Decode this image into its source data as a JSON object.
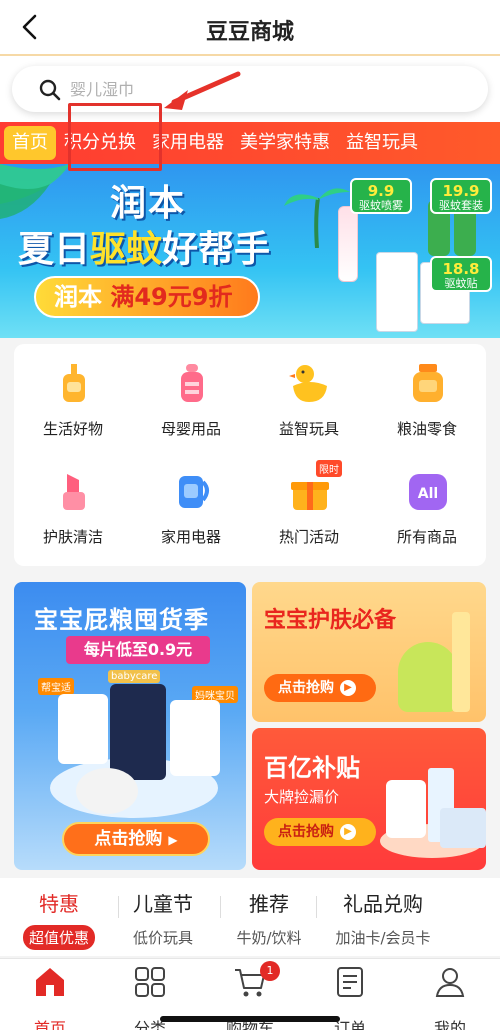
{
  "header": {
    "title": "豆豆商城"
  },
  "search": {
    "placeholder": "婴儿湿巾"
  },
  "category_tabs": [
    "首页",
    "积分兑换",
    "家用电器",
    "美学家特惠",
    "益智玩具"
  ],
  "banner": {
    "title_line1": "润本",
    "title_line2_pre": "夏日",
    "title_line2_highlight": "驱蚊",
    "title_line2_post": "好帮手",
    "pill_brand": "润本",
    "pill_offer": "满49元9折",
    "tags": [
      {
        "price": "9.9",
        "name": "驱蚊喷雾"
      },
      {
        "price": "19.9",
        "name": "驱蚊套装"
      },
      {
        "price": "18.8",
        "name": "驱蚊贴"
      }
    ]
  },
  "quick_grid": [
    {
      "label": "生活好物",
      "icon": "pump-bottle-icon",
      "color": "#ffb52e"
    },
    {
      "label": "母婴用品",
      "icon": "baby-bottle-icon",
      "color": "#ff6b8a"
    },
    {
      "label": "益智玩具",
      "icon": "duck-toy-icon",
      "color": "#ffc21f"
    },
    {
      "label": "粮油零食",
      "icon": "jar-icon",
      "color": "#ff9c1a"
    },
    {
      "label": "护肤清洁",
      "icon": "lipstick-icon",
      "color": "#ff5f7e"
    },
    {
      "label": "家用电器",
      "icon": "kettle-icon",
      "color": "#3f8ef7"
    },
    {
      "label": "热门活动",
      "icon": "gift-box-icon",
      "color": "#ffb21c",
      "badge": "限时"
    },
    {
      "label": "所有商品",
      "icon": "all-icon",
      "color": "#a166f2",
      "text": "All"
    }
  ],
  "promo_left": {
    "title": "宝宝屁粮囤货季",
    "subtitle": "每片低至0.9元",
    "brand_labels": [
      "帮宝适",
      "babycare",
      "妈咪宝贝"
    ],
    "button": "点击抢购"
  },
  "promo_right_top": {
    "title": "宝宝护肤必备",
    "button": "点击抢购"
  },
  "promo_right_bottom": {
    "title": "百亿补贴",
    "subtitle": "大牌捡漏价",
    "button": "点击抢购"
  },
  "feature_tabs": [
    {
      "title": "特惠",
      "sub": "超值优惠"
    },
    {
      "title": "儿童节",
      "sub": "低价玩具"
    },
    {
      "title": "推荐",
      "sub": "牛奶/饮料"
    },
    {
      "title": "礼品兑购",
      "sub": "加油卡/会员卡"
    }
  ],
  "bottom_nav": [
    {
      "label": "首页",
      "icon": "home-icon"
    },
    {
      "label": "分类",
      "icon": "grid-icon"
    },
    {
      "label": "购物车",
      "icon": "cart-icon",
      "badge": "1"
    },
    {
      "label": "订单",
      "icon": "order-list-icon"
    },
    {
      "label": "我的",
      "icon": "user-icon"
    }
  ],
  "colors": {
    "accent_red": "#e22a26",
    "tab_bar": "#ff3b32",
    "active_tab": "#ffc72c"
  }
}
